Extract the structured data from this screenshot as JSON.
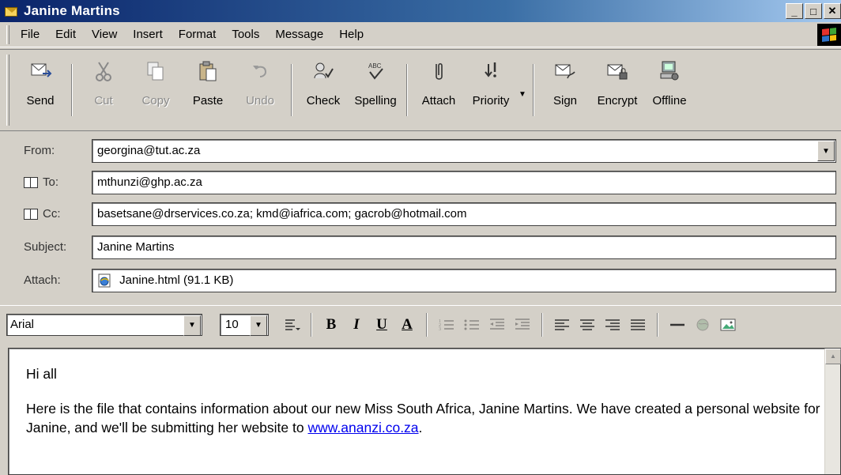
{
  "window": {
    "title": "Janine Martins"
  },
  "menu": [
    "File",
    "Edit",
    "View",
    "Insert",
    "Format",
    "Tools",
    "Message",
    "Help"
  ],
  "toolbar": {
    "send": "Send",
    "cut": "Cut",
    "copy": "Copy",
    "paste": "Paste",
    "undo": "Undo",
    "check": "Check",
    "spelling": "Spelling",
    "attach": "Attach",
    "priority": "Priority",
    "sign": "Sign",
    "encrypt": "Encrypt",
    "offline": "Offline"
  },
  "fields": {
    "from_label": "From:",
    "from_value": "georgina@tut.ac.za",
    "to_label": "To:",
    "to_value": "mthunzi@ghp.ac.za",
    "cc_label": "Cc:",
    "cc_value": "basetsane@drservices.co.za; kmd@iafrica.com; gacrob@hotmail.com",
    "subject_label": "Subject:",
    "subject_value": "Janine Martins",
    "attach_label": "Attach:",
    "attach_value": "Janine.html (91.1 KB)"
  },
  "format": {
    "font": "Arial",
    "size": "10",
    "bold": "B",
    "italic": "I",
    "underline": "U",
    "color": "A"
  },
  "body": {
    "greeting": "Hi all",
    "text": "Here is the file that contains information about our new Miss South Africa, Janine Martins. We have created a personal website for Janine, and we'll be submitting her website to ",
    "link": "www.ananzi.co.za",
    "end": "."
  }
}
